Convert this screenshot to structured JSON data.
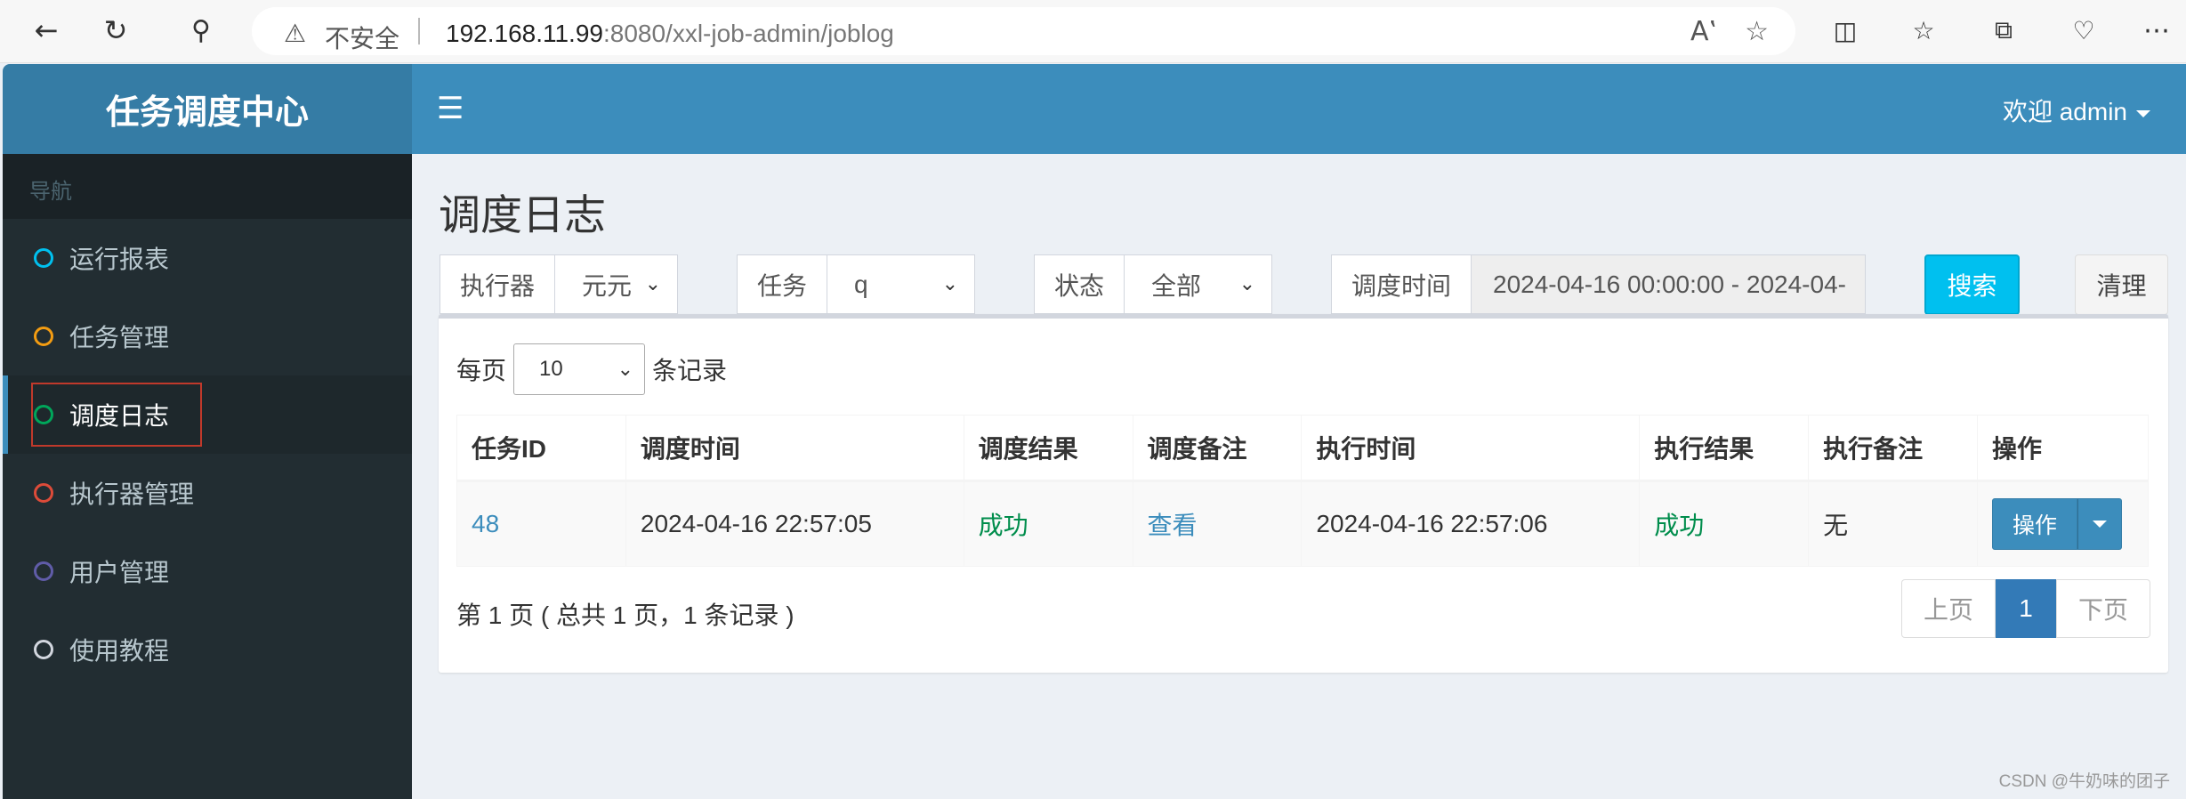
{
  "browser": {
    "security_label": "不安全",
    "url_host": "192.168.11.99",
    "url_rest": ":8080/xxl-job-admin/joblog"
  },
  "app": {
    "logo": "任务调度中心",
    "welcome": "欢迎 admin"
  },
  "sidebar": {
    "header": "导航",
    "items": [
      {
        "label": "运行报表",
        "color": "#00c0ef"
      },
      {
        "label": "任务管理",
        "color": "#f39c12"
      },
      {
        "label": "调度日志",
        "color": "#00a65a"
      },
      {
        "label": "执行器管理",
        "color": "#dd4b39"
      },
      {
        "label": "用户管理",
        "color": "#605ca8"
      },
      {
        "label": "使用教程",
        "color": "#d2d6de"
      }
    ]
  },
  "main": {
    "title": "调度日志",
    "filters": {
      "executor_label": "执行器",
      "executor_value": "元元",
      "task_label": "任务",
      "task_value": "q",
      "status_label": "状态",
      "status_value": "全部",
      "time_label": "调度时间",
      "time_value": "2024-04-16 00:00:00 - 2024-04-"
    },
    "search_button": "搜索",
    "clear_button": "清理",
    "per_page_prefix": "每页",
    "per_page_value": "10",
    "per_page_suffix": "条记录",
    "table": {
      "headers": [
        "任务ID",
        "调度时间",
        "调度结果",
        "调度备注",
        "执行时间",
        "执行结果",
        "执行备注",
        "操作"
      ],
      "rows": [
        {
          "task_id": "48",
          "trigger_time": "2024-04-16 22:57:05",
          "trigger_result": "成功",
          "trigger_note": "查看",
          "handle_time": "2024-04-16 22:57:06",
          "handle_result": "成功",
          "handle_note": "无",
          "action": "操作"
        }
      ]
    },
    "page_info": "第 1 页 ( 总共 1 页，1 条记录 )",
    "pager": {
      "prev": "上页",
      "current": "1",
      "next": "下页"
    }
  },
  "watermark": "CSDN @牛奶味的团子"
}
